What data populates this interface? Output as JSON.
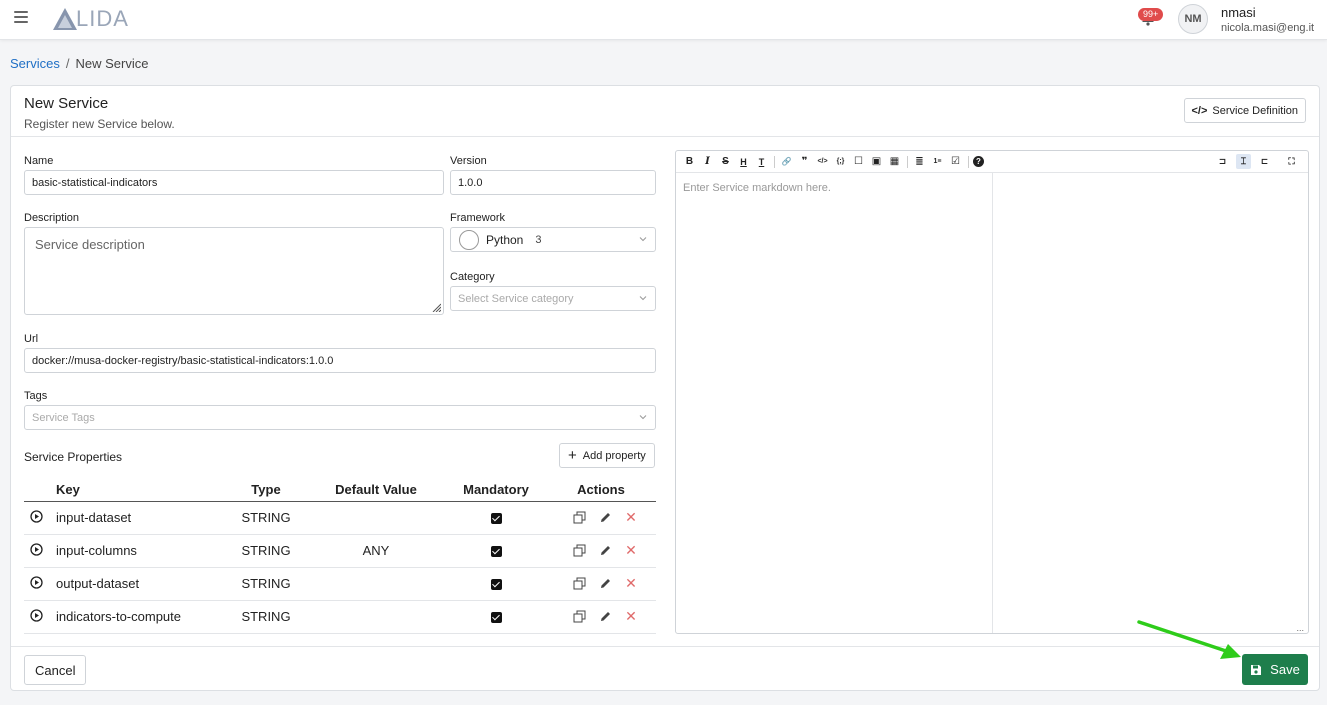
{
  "app": {
    "logo_text": "LIDA",
    "notif_badge": "99+"
  },
  "user": {
    "initials": "NM",
    "name": "nmasi",
    "email": "nicola.masi@eng.it"
  },
  "breadcrumb": {
    "parent": "Services",
    "separator": "/",
    "current": "New Service"
  },
  "card": {
    "title": "New Service",
    "subtitle": "Register new Service below.",
    "service_definition_label": "Service Definition"
  },
  "form": {
    "name": {
      "label": "Name",
      "value": "basic-statistical-indicators"
    },
    "version": {
      "label": "Version",
      "value": "1.0.0"
    },
    "description": {
      "label": "Description",
      "placeholder": "Service description"
    },
    "framework": {
      "label": "Framework",
      "value": "Python",
      "version": "3"
    },
    "category": {
      "label": "Category",
      "placeholder": "Select Service category"
    },
    "url": {
      "label": "Url",
      "value": "docker://musa-docker-registry/basic-statistical-indicators:1.0.0"
    },
    "tags": {
      "label": "Tags",
      "placeholder": "Service Tags"
    }
  },
  "properties": {
    "title": "Service Properties",
    "add_label": "Add property",
    "headers": {
      "key": "Key",
      "type": "Type",
      "default": "Default Value",
      "mandatory": "Mandatory",
      "actions": "Actions"
    },
    "rows": [
      {
        "key": "input-dataset",
        "type": "STRING",
        "default": "",
        "mandatory": true
      },
      {
        "key": "input-columns",
        "type": "STRING",
        "default": "ANY",
        "mandatory": true
      },
      {
        "key": "output-dataset",
        "type": "STRING",
        "default": "",
        "mandatory": true
      },
      {
        "key": "indicators-to-compute",
        "type": "STRING",
        "default": "",
        "mandatory": true
      }
    ]
  },
  "editor": {
    "placeholder": "Enter Service markdown here.",
    "toolbar_icons": [
      "bold-icon",
      "italic-icon",
      "strikethrough-icon",
      "heading-icon",
      "title-icon",
      "link-icon",
      "quote-icon",
      "code-icon",
      "code-block-icon",
      "comment-icon",
      "image-icon",
      "table-icon",
      "unordered-list-icon",
      "ordered-list-icon",
      "checklist-icon",
      "help-icon"
    ],
    "toolbar_glyphs": [
      "B",
      "I",
      "S",
      "H",
      "T",
      "🔗",
      "❞",
      "</>",
      "{;}",
      "☐",
      "▣",
      "▦",
      "≣",
      "1≡",
      "☑",
      "?"
    ],
    "statusbar": "..."
  },
  "footer": {
    "cancel_label": "Cancel",
    "save_label": "Save"
  },
  "colors": {
    "primary_link": "#1f6fc5",
    "save_button": "#1e7e4c",
    "badge": "#e04b4b",
    "annotation_arrow": "#2ecc1a"
  }
}
